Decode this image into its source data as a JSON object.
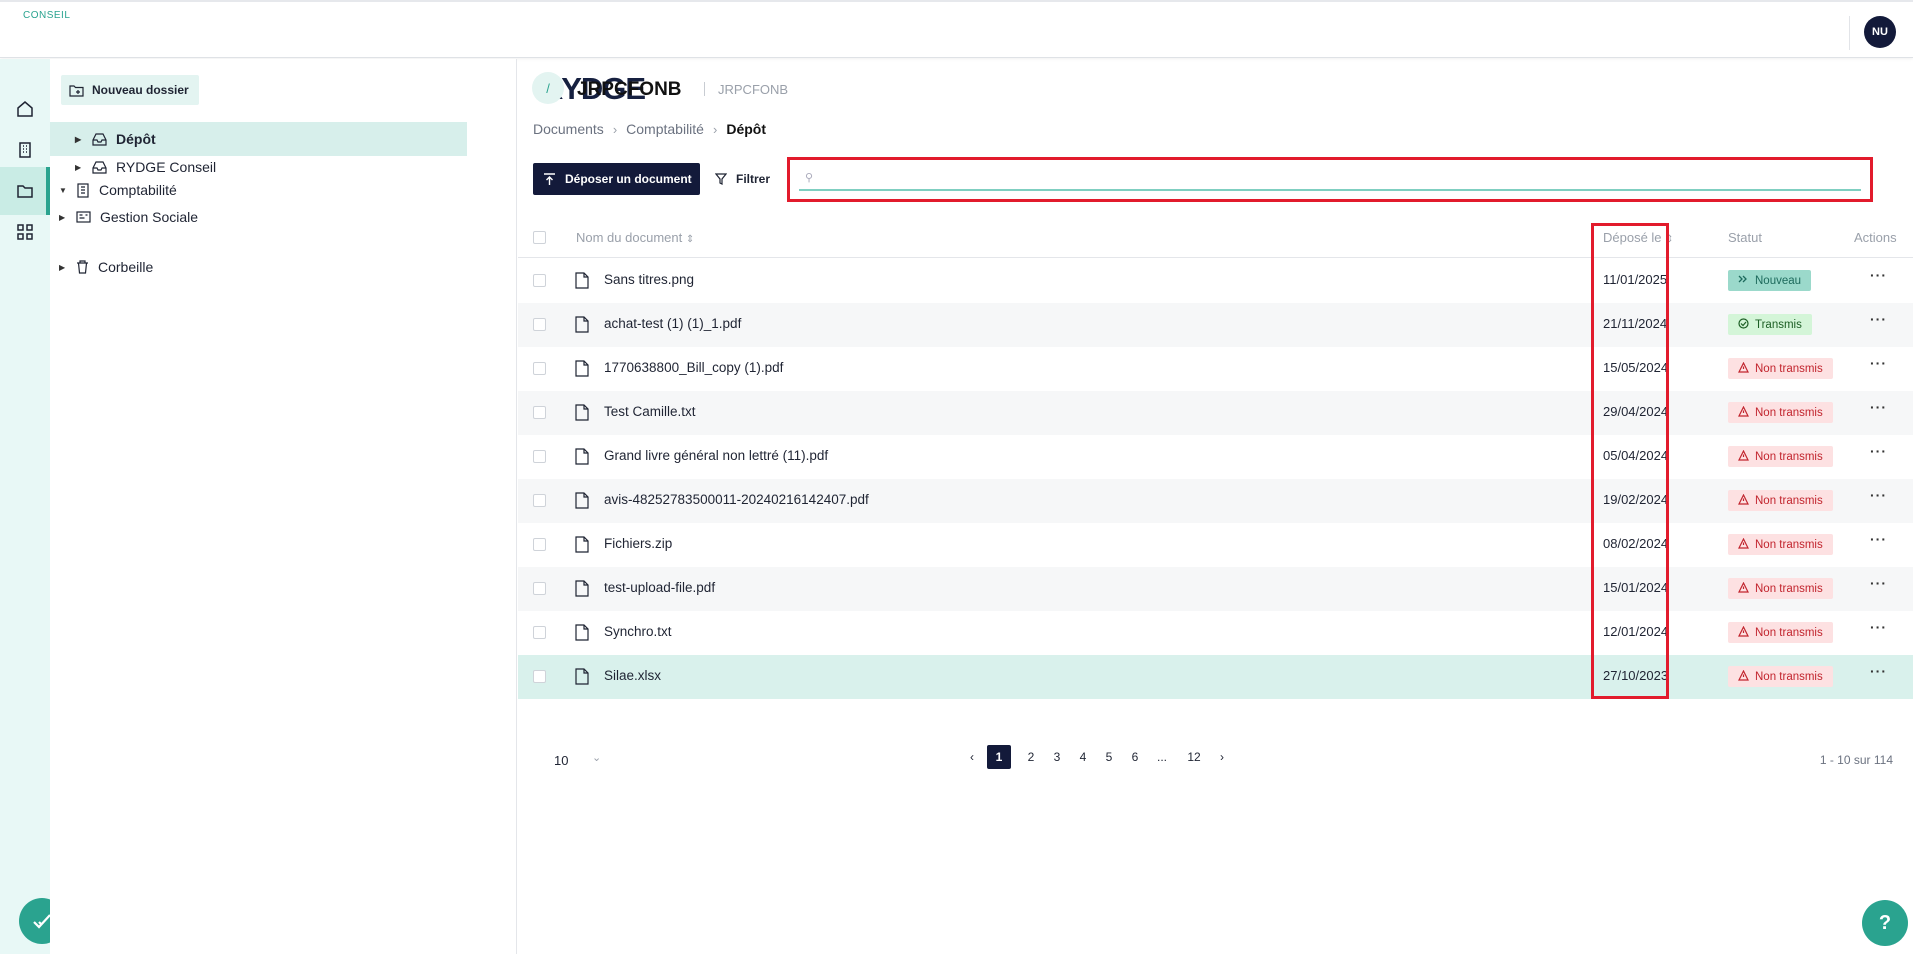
{
  "app": {
    "logo_main": "RYDGE",
    "logo_sub": "CONSEIL",
    "user_initials": "NU"
  },
  "sidebar": {
    "new_folder_label": "Nouveau dossier",
    "items": [
      {
        "label": "Comptabilité"
      },
      {
        "label": "Dépôt"
      },
      {
        "label": "RYDGE Conseil"
      },
      {
        "label": "Gestion Sociale"
      },
      {
        "label": "Corbeille"
      }
    ]
  },
  "header": {
    "icon": "/",
    "title": "JRPCFONB",
    "subtitle": "JRPCFONB"
  },
  "breadcrumb": [
    "Documents",
    "Comptabilité",
    "Dépôt"
  ],
  "toolbar": {
    "upload_label": "Déposer un document",
    "filter_label": "Filtrer",
    "search_placeholder": ""
  },
  "table": {
    "headers": {
      "name": "Nom du document",
      "date": "Déposé le",
      "status": "Statut",
      "actions": "Actions"
    },
    "rows": [
      {
        "name": "Sans titres.png",
        "ext": "PNG",
        "date": "11/01/2025",
        "status": "Nouveau",
        "kind": "new"
      },
      {
        "name": "achat-test (1) (1)_1.pdf",
        "ext": "PDF",
        "date": "21/11/2024",
        "status": "Transmis",
        "kind": "ok"
      },
      {
        "name": "1770638800_Bill_copy (1).pdf",
        "ext": "PDF",
        "date": "15/05/2024",
        "status": "Non transmis",
        "kind": "ko"
      },
      {
        "name": "Test Camille.txt",
        "ext": "TXT",
        "date": "29/04/2024",
        "status": "Non transmis",
        "kind": "ko"
      },
      {
        "name": "Grand livre général non lettré (11).pdf",
        "ext": "PDF",
        "date": "05/04/2024",
        "status": "Non transmis",
        "kind": "ko"
      },
      {
        "name": "avis-48252783500011-20240216142407.pdf",
        "ext": "PDF",
        "date": "19/02/2024",
        "status": "Non transmis",
        "kind": "ko"
      },
      {
        "name": "Fichiers.zip",
        "ext": "ZIP",
        "date": "08/02/2024",
        "status": "Non transmis",
        "kind": "ko"
      },
      {
        "name": "test-upload-file.pdf",
        "ext": "PDF",
        "date": "15/01/2024",
        "status": "Non transmis",
        "kind": "ko"
      },
      {
        "name": "Synchro.txt",
        "ext": "TXT",
        "date": "12/01/2024",
        "status": "Non transmis",
        "kind": "ko"
      },
      {
        "name": "Silae.xlsx",
        "ext": "XLSX",
        "date": "27/10/2023",
        "status": "Non transmis",
        "kind": "ko"
      }
    ]
  },
  "pagination": {
    "per_page": "10",
    "pages": [
      "1",
      "2",
      "3",
      "4",
      "5",
      "6",
      "...",
      "12"
    ],
    "current": "1",
    "range_text": "1 - 10 sur 114"
  },
  "help_label": "?"
}
